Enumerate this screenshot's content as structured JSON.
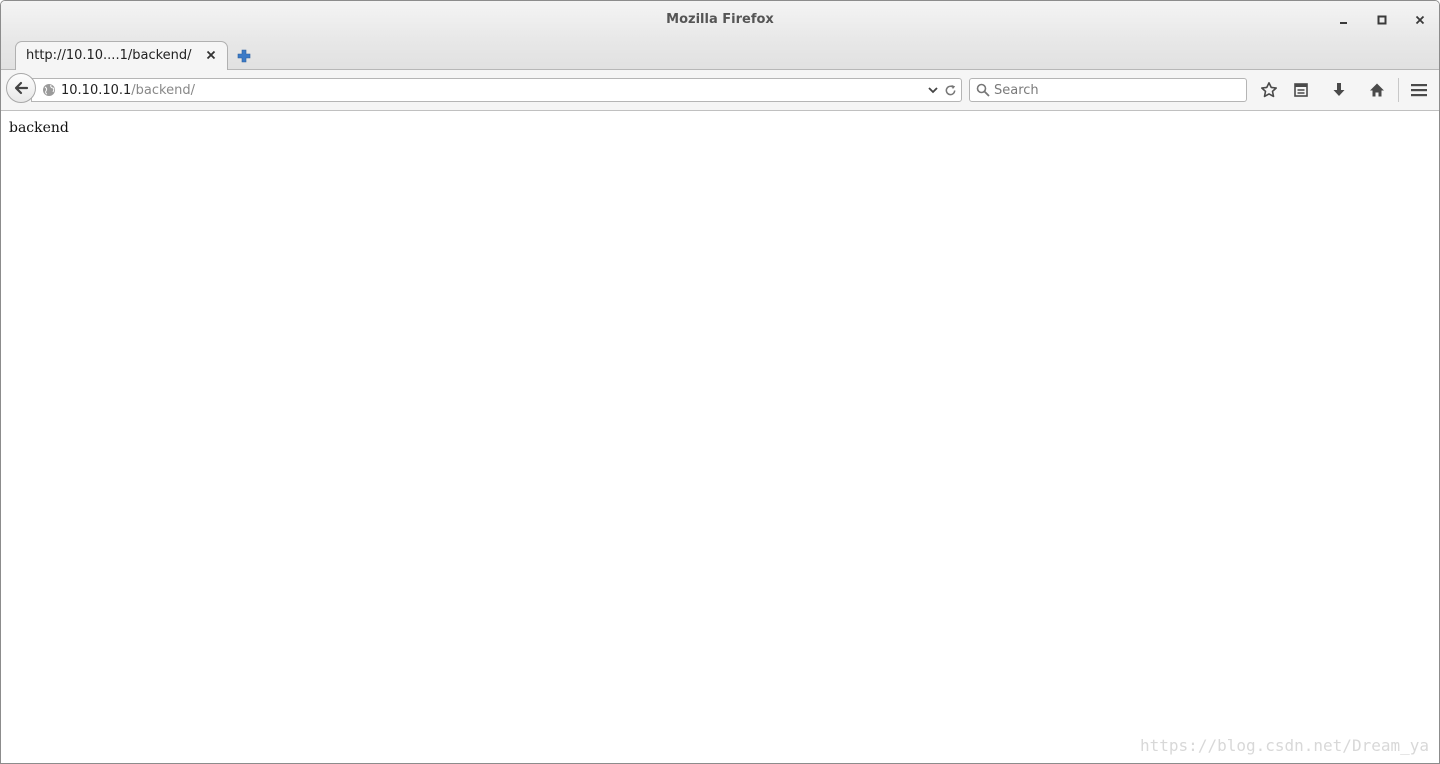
{
  "window": {
    "title": "Mozilla Firefox"
  },
  "tabs": [
    {
      "label": "http://10.10....1/backend/",
      "active": true
    }
  ],
  "navbar": {
    "url_host": "10.10.10.1",
    "url_path": "/backend/",
    "search_placeholder": "Search"
  },
  "icons": {
    "back": "back-arrow-icon",
    "globe": "globe-icon",
    "dropdown": "chevron-down-icon",
    "reload": "reload-icon",
    "search": "search-icon",
    "bookmark": "star-icon",
    "reading_list": "bookmarks-list-icon",
    "downloads": "download-icon",
    "home": "home-icon",
    "menu": "hamburger-menu-icon"
  },
  "page": {
    "body_text": "backend"
  },
  "watermark": {
    "text": "https://blog.csdn.net/Dream_ya"
  },
  "colors": {
    "tab_plus": "#3b7ac7",
    "icon": "#4a4a4a"
  }
}
